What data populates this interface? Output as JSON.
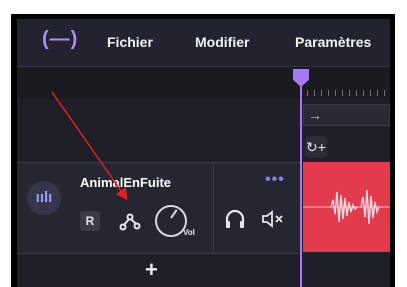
{
  "app": {
    "logo_glyph": "(—)"
  },
  "menubar": {
    "items": [
      "Fichier",
      "Modifier",
      "Paramètres"
    ]
  },
  "timeline": {
    "arrow_glyph": "→",
    "loop_glyph": "↻+"
  },
  "track": {
    "name": "AnimalEnFuite",
    "record_label": "R",
    "volume_label": "Vol",
    "more_glyph": "•••",
    "icon_glyph": "ıılı"
  },
  "add_track": {
    "glyph": "+"
  },
  "colors": {
    "accent": "#a779f7",
    "clip": "#e23b4e",
    "annotation": "#e02020",
    "background": "#1f1f27"
  }
}
